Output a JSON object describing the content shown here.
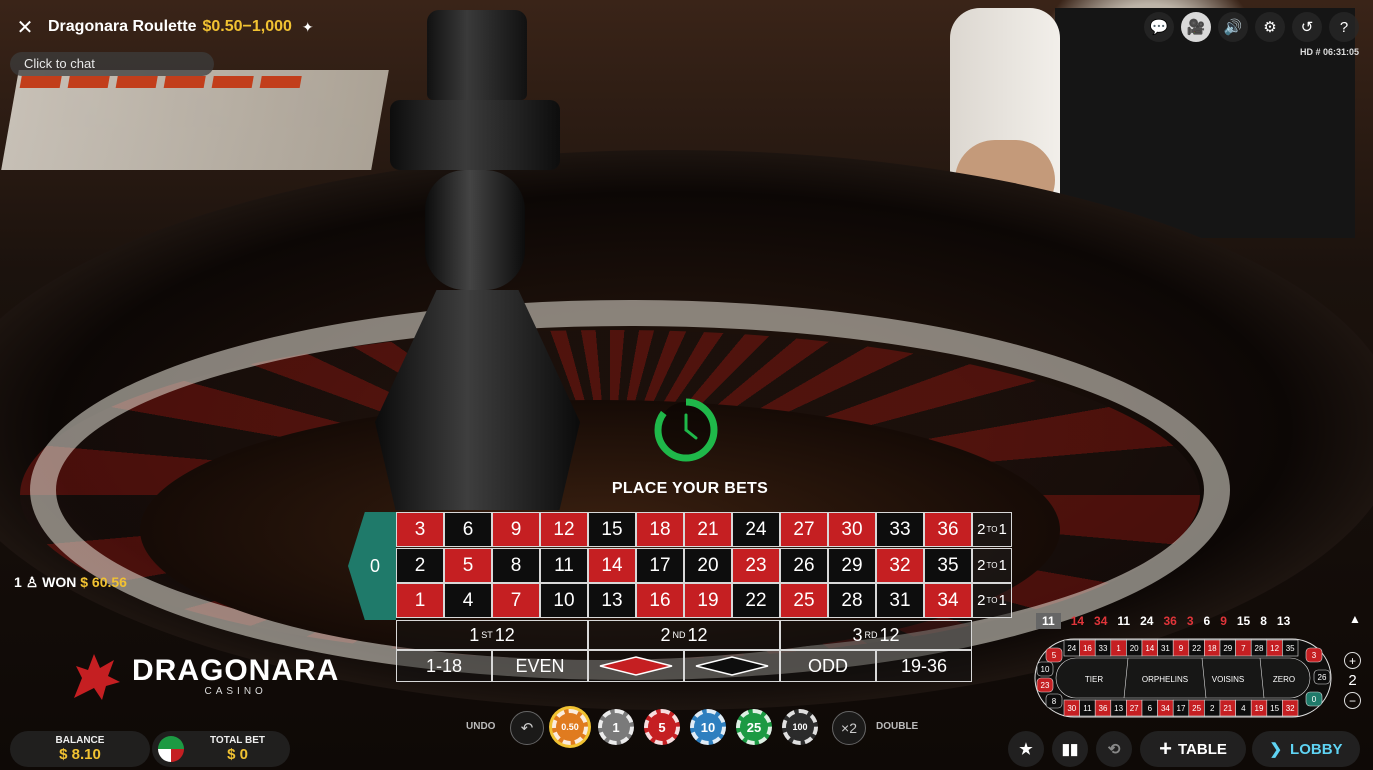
{
  "header": {
    "title": "Dragonara Roulette",
    "limits": "$0.50−1,000",
    "pin_icon": "pin-icon",
    "close_icon": "close-icon"
  },
  "chat": {
    "placeholder": "Click to chat"
  },
  "top_icons": [
    "chat-icon",
    "video-icon",
    "sound-icon",
    "settings-icon",
    "history-icon",
    "help-icon"
  ],
  "stream_info": "HD  # 06:31:05",
  "status": {
    "text": "PLACE YOUR BETS"
  },
  "board": {
    "zero": "0",
    "rows": [
      [
        {
          "n": "3",
          "c": "red"
        },
        {
          "n": "6",
          "c": "black"
        },
        {
          "n": "9",
          "c": "red"
        },
        {
          "n": "12",
          "c": "red"
        },
        {
          "n": "15",
          "c": "black"
        },
        {
          "n": "18",
          "c": "red"
        },
        {
          "n": "21",
          "c": "red"
        },
        {
          "n": "24",
          "c": "black"
        },
        {
          "n": "27",
          "c": "red"
        },
        {
          "n": "30",
          "c": "red"
        },
        {
          "n": "33",
          "c": "black"
        },
        {
          "n": "36",
          "c": "red"
        }
      ],
      [
        {
          "n": "2",
          "c": "black"
        },
        {
          "n": "5",
          "c": "red"
        },
        {
          "n": "8",
          "c": "black"
        },
        {
          "n": "11",
          "c": "black"
        },
        {
          "n": "14",
          "c": "red"
        },
        {
          "n": "17",
          "c": "black"
        },
        {
          "n": "20",
          "c": "black"
        },
        {
          "n": "23",
          "c": "red"
        },
        {
          "n": "26",
          "c": "black"
        },
        {
          "n": "29",
          "c": "black"
        },
        {
          "n": "32",
          "c": "red"
        },
        {
          "n": "35",
          "c": "black"
        }
      ],
      [
        {
          "n": "1",
          "c": "red"
        },
        {
          "n": "4",
          "c": "black"
        },
        {
          "n": "7",
          "c": "red"
        },
        {
          "n": "10",
          "c": "black"
        },
        {
          "n": "13",
          "c": "black"
        },
        {
          "n": "16",
          "c": "red"
        },
        {
          "n": "19",
          "c": "red"
        },
        {
          "n": "22",
          "c": "black"
        },
        {
          "n": "25",
          "c": "red"
        },
        {
          "n": "28",
          "c": "black"
        },
        {
          "n": "31",
          "c": "black"
        },
        {
          "n": "34",
          "c": "red"
        }
      ]
    ],
    "column_bet": {
      "pre": "2",
      "sup": "TO",
      "post": "1"
    },
    "dozens": [
      {
        "pre": "1",
        "sup": "ST",
        "post": "12"
      },
      {
        "pre": "2",
        "sup": "ND",
        "post": "12"
      },
      {
        "pre": "3",
        "sup": "RD",
        "post": "12"
      }
    ],
    "outside": {
      "low": "1-18",
      "even": "EVEN",
      "odd": "ODD",
      "high": "19-36"
    },
    "colors": {
      "red": "#c51f22",
      "black": "#0d0d0d",
      "zero": "#1f7a6a"
    }
  },
  "winners": {
    "count": "1",
    "label": "WON",
    "amount": "$ 60.56"
  },
  "brand": {
    "name": "DRAGONARA",
    "sub": "CASINO"
  },
  "balance": {
    "label": "BALANCE",
    "value": "$ 8.10"
  },
  "total_bet": {
    "label": "TOTAL BET",
    "value": "$ 0"
  },
  "controls": {
    "undo_label": "UNDO",
    "double_label": "DOUBLE",
    "double_value": "×2",
    "chips": [
      {
        "value": "0.50",
        "color": "#e07b1f",
        "selected": true
      },
      {
        "value": "1",
        "color": "#7a7a7a"
      },
      {
        "value": "5",
        "color": "#c51f22"
      },
      {
        "value": "10",
        "color": "#2e7fbf"
      },
      {
        "value": "25",
        "color": "#1c9a43"
      },
      {
        "value": "100",
        "color": "#2b2b2b"
      }
    ]
  },
  "bottom_right": {
    "favourites_icon": "star-icon",
    "stats_icon": "stats-icon",
    "repeat_icon": "repeat-icon",
    "table_label": "TABLE",
    "lobby_label": "LOBBY"
  },
  "history": [
    {
      "n": "11",
      "c": "highlight"
    },
    {
      "n": "14",
      "c": "red"
    },
    {
      "n": "34",
      "c": "red"
    },
    {
      "n": "11",
      "c": "white"
    },
    {
      "n": "24",
      "c": "white"
    },
    {
      "n": "36",
      "c": "red"
    },
    {
      "n": "3",
      "c": "red"
    },
    {
      "n": "6",
      "c": "white"
    },
    {
      "n": "9",
      "c": "red"
    },
    {
      "n": "15",
      "c": "white"
    },
    {
      "n": "8",
      "c": "white"
    },
    {
      "n": "13",
      "c": "white"
    }
  ],
  "racetrack": {
    "top": [
      "24",
      "16",
      "33",
      "1",
      "20",
      "14",
      "31",
      "9",
      "22",
      "18",
      "29",
      "7",
      "28",
      "12",
      "35"
    ],
    "bottom": [
      "30",
      "11",
      "36",
      "13",
      "27",
      "6",
      "34",
      "17",
      "25",
      "2",
      "21",
      "4",
      "19",
      "15",
      "32"
    ],
    "left": [
      "5",
      "10",
      "23",
      "8"
    ],
    "right": [
      "3",
      "26",
      "0"
    ],
    "sections": [
      "TIER",
      "ORPHELINS",
      "VOISINS",
      "ZERO"
    ],
    "red_numbers": [
      "1",
      "3",
      "5",
      "7",
      "9",
      "12",
      "14",
      "16",
      "18",
      "19",
      "21",
      "23",
      "25",
      "27",
      "30",
      "32",
      "34",
      "36"
    ]
  },
  "zoom": {
    "value": "2"
  }
}
